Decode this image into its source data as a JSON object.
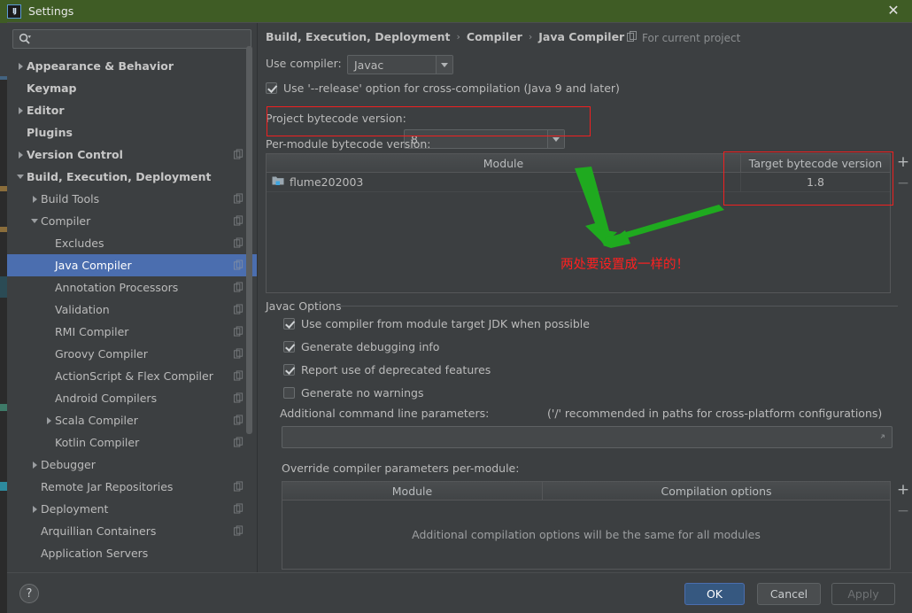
{
  "window": {
    "title": "Settings",
    "app_icon": "intellij-idea-icon",
    "close_icon": "close-icon",
    "titlebar_color": "#3f5c25"
  },
  "search": {
    "value": "",
    "placeholder": "",
    "icon": "search-icon"
  },
  "sidebar": {
    "items": [
      {
        "label": "Appearance & Behavior",
        "level": 0,
        "twisty": "right",
        "bold": true,
        "copy": false,
        "selected": false
      },
      {
        "label": "Keymap",
        "level": 0,
        "twisty": "none",
        "bold": true,
        "copy": false,
        "selected": false
      },
      {
        "label": "Editor",
        "level": 0,
        "twisty": "right",
        "bold": true,
        "copy": false,
        "selected": false
      },
      {
        "label": "Plugins",
        "level": 0,
        "twisty": "none",
        "bold": true,
        "copy": false,
        "selected": false
      },
      {
        "label": "Version Control",
        "level": 0,
        "twisty": "right",
        "bold": true,
        "copy": true,
        "selected": false
      },
      {
        "label": "Build, Execution, Deployment",
        "level": 0,
        "twisty": "down",
        "bold": true,
        "copy": false,
        "selected": false
      },
      {
        "label": "Build Tools",
        "level": 1,
        "twisty": "right",
        "bold": false,
        "copy": true,
        "selected": false
      },
      {
        "label": "Compiler",
        "level": 1,
        "twisty": "down",
        "bold": false,
        "copy": true,
        "selected": false
      },
      {
        "label": "Excludes",
        "level": 2,
        "twisty": "none",
        "bold": false,
        "copy": true,
        "selected": false
      },
      {
        "label": "Java Compiler",
        "level": 2,
        "twisty": "none",
        "bold": false,
        "copy": true,
        "selected": true
      },
      {
        "label": "Annotation Processors",
        "level": 2,
        "twisty": "none",
        "bold": false,
        "copy": true,
        "selected": false
      },
      {
        "label": "Validation",
        "level": 2,
        "twisty": "none",
        "bold": false,
        "copy": true,
        "selected": false
      },
      {
        "label": "RMI Compiler",
        "level": 2,
        "twisty": "none",
        "bold": false,
        "copy": true,
        "selected": false
      },
      {
        "label": "Groovy Compiler",
        "level": 2,
        "twisty": "none",
        "bold": false,
        "copy": true,
        "selected": false
      },
      {
        "label": "ActionScript & Flex Compiler",
        "level": 2,
        "twisty": "none",
        "bold": false,
        "copy": true,
        "selected": false
      },
      {
        "label": "Android Compilers",
        "level": 2,
        "twisty": "none",
        "bold": false,
        "copy": true,
        "selected": false
      },
      {
        "label": "Scala Compiler",
        "level": 2,
        "twisty": "right",
        "bold": false,
        "copy": true,
        "selected": false
      },
      {
        "label": "Kotlin Compiler",
        "level": 2,
        "twisty": "none",
        "bold": false,
        "copy": true,
        "selected": false
      },
      {
        "label": "Debugger",
        "level": 1,
        "twisty": "right",
        "bold": false,
        "copy": false,
        "selected": false
      },
      {
        "label": "Remote Jar Repositories",
        "level": 1,
        "twisty": "none",
        "bold": false,
        "copy": true,
        "selected": false
      },
      {
        "label": "Deployment",
        "level": 1,
        "twisty": "right",
        "bold": false,
        "copy": true,
        "selected": false
      },
      {
        "label": "Arquillian Containers",
        "level": 1,
        "twisty": "none",
        "bold": false,
        "copy": true,
        "selected": false
      },
      {
        "label": "Application Servers",
        "level": 1,
        "twisty": "none",
        "bold": false,
        "copy": false,
        "selected": false
      }
    ]
  },
  "panel": {
    "breadcrumb": [
      "Build, Execution, Deployment",
      "Compiler",
      "Java Compiler"
    ],
    "breadcrumb_separator": "›",
    "for_current_project": "For current project",
    "for_current_project_icon": "copy-scope-icon",
    "use_compiler_label": "Use compiler:",
    "use_compiler_value": "Javac",
    "release_option": {
      "label": "Use '--release' option for cross-compilation (Java 9 and later)",
      "checked": true
    },
    "project_bytecode_label": "Project bytecode version:",
    "project_bytecode_value": "8",
    "per_module_label": "Per-module bytecode version:",
    "module_table": {
      "columns": [
        "Module",
        "Target bytecode version"
      ],
      "rows": [
        {
          "module": "flume202003",
          "module_icon": "module-folder-icon",
          "target": "1.8"
        }
      ],
      "add_label": "+",
      "remove_label": "−"
    },
    "javac_options": {
      "title": "Javac Options",
      "checkboxes": [
        {
          "label": "Use compiler from module target JDK when possible",
          "checked": true
        },
        {
          "label": "Generate debugging info",
          "checked": true
        },
        {
          "label": "Report use of deprecated features",
          "checked": true
        },
        {
          "label": "Generate no warnings",
          "checked": false
        }
      ],
      "additional_params_label": "Additional command line parameters:",
      "additional_params_hint": "('/' recommended in paths for cross-platform configurations)",
      "additional_params_value": "",
      "expand_icon": "expand-field-icon",
      "override_label": "Override compiler parameters per-module:",
      "override_table": {
        "columns": [
          "Module",
          "Compilation options"
        ],
        "empty_text": "Additional compilation options will be the same for all modules",
        "add_label": "+",
        "remove_label": "−"
      }
    }
  },
  "annotations": {
    "note_text": "两处要设置成一样的！",
    "note_color": "#ff2020",
    "highlight_color": "#f02020",
    "arrow_color": "#1faa1f"
  },
  "footer": {
    "help_label": "?",
    "ok_label": "OK",
    "cancel_label": "Cancel",
    "apply_label": "Apply",
    "ok_color": "#365880"
  }
}
